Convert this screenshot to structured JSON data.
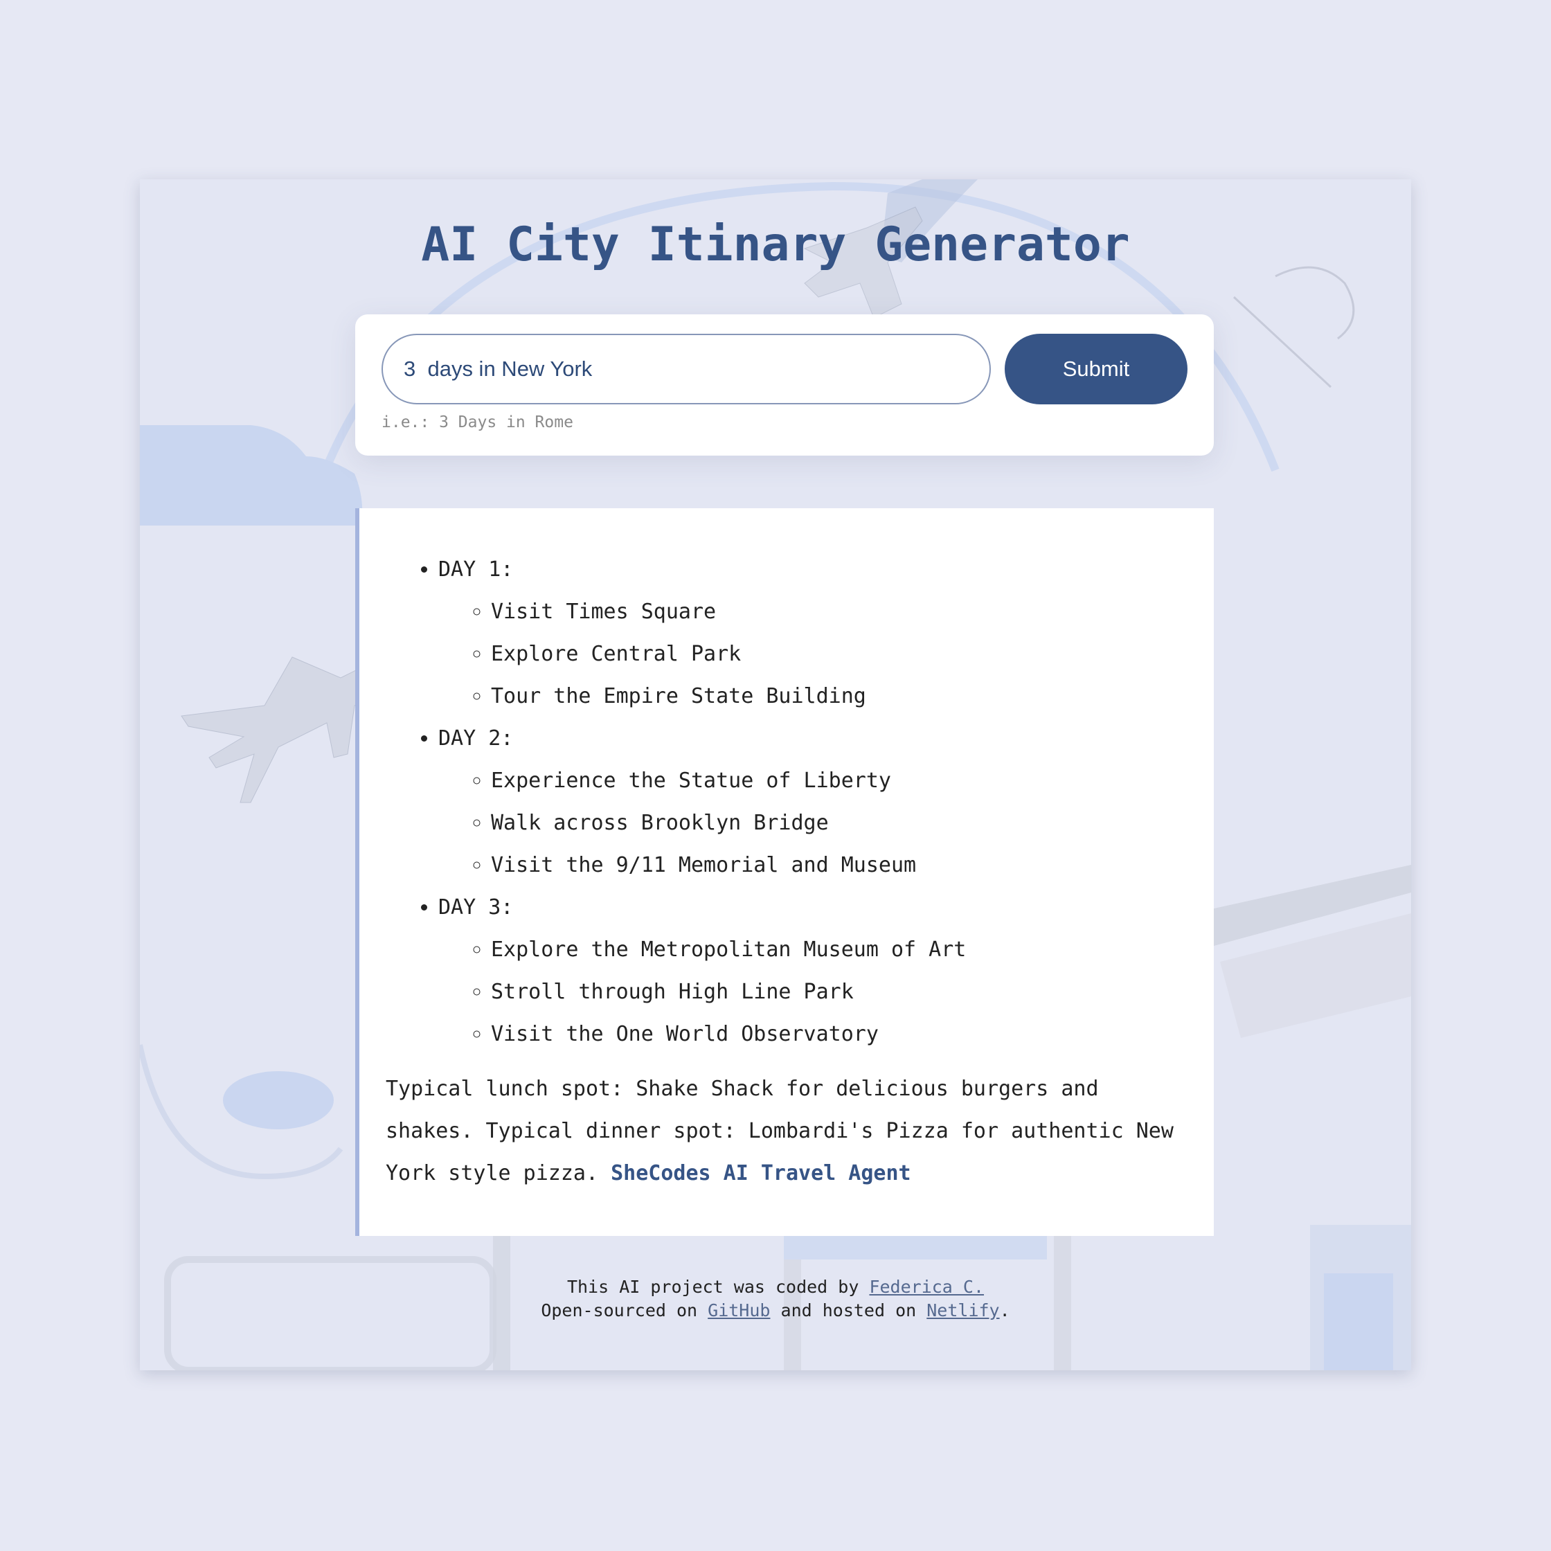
{
  "app": {
    "title": "AI City Itinary Generator"
  },
  "form": {
    "input_value": "3  days in New York",
    "hint": "i.e.: 3 Days in Rome",
    "submit_label": "Submit"
  },
  "itinerary": {
    "days": [
      {
        "label": "DAY 1:",
        "activities": [
          "Visit Times Square",
          "Explore Central Park",
          "Tour the Empire State Building"
        ]
      },
      {
        "label": "DAY 2:",
        "activities": [
          "Experience the Statue of Liberty",
          "Walk across Brooklyn Bridge",
          "Visit the 9/11 Memorial and Museum"
        ]
      },
      {
        "label": "DAY 3:",
        "activities": [
          "Explore the Metropolitan Museum of Art",
          "Stroll through High Line Park",
          "Visit the One World Observatory"
        ]
      }
    ],
    "summary": "Typical lunch spot: Shake Shack for delicious burgers and shakes. Typical dinner spot: Lombardi's Pizza for authentic New York style pizza.",
    "signature": "SheCodes AI Travel Agent"
  },
  "footer": {
    "line1_text": "This AI project was coded by ",
    "author_link": "Federica C.",
    "line2_prefix": "Open-sourced on ",
    "github_link": "GitHub",
    "line2_middle": " and hosted on ",
    "netlify_link": "Netlify",
    "line2_suffix": "."
  },
  "colors": {
    "page_background": "#e6e8f4",
    "brand_blue": "#365486",
    "result_border": "#a4b4de"
  }
}
